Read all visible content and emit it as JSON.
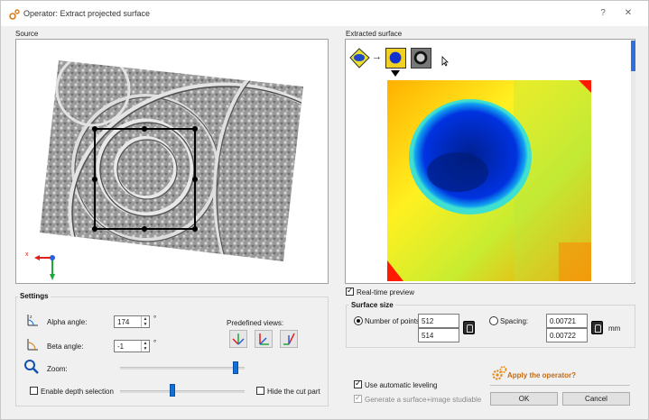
{
  "window": {
    "title": "Operator: Extract projected surface",
    "help_glyph": "?",
    "close_glyph": "✕"
  },
  "source": {
    "label": "Source"
  },
  "extracted": {
    "label": "Extracted surface",
    "arrow_glyph": "→"
  },
  "settings": {
    "title": "Settings",
    "alpha_label": "Alpha angle:",
    "alpha_value": "174",
    "beta_label": "Beta angle:",
    "beta_value": "-1",
    "degree_glyph": "°",
    "zoom_label": "Zoom:",
    "zoom_level": 0.95,
    "depth_label": "Enable depth selection",
    "depth_checked": false,
    "depth_level": 0.42,
    "hide_cut_label": "Hide the cut part",
    "hide_cut_checked": false,
    "predefined_label": "Predefined views:"
  },
  "realtime": {
    "label": "Real-time preview",
    "checked": true
  },
  "surface_size": {
    "title": "Surface size",
    "number_label": "Number of points:",
    "points_x": "512",
    "points_y": "514",
    "spacing_label": "Spacing:",
    "spacing_x": "0.00721",
    "spacing_y": "0.00722",
    "unit": "mm",
    "selected": "number"
  },
  "leveling": {
    "label": "Use automatic leveling",
    "checked": true
  },
  "generate": {
    "label": "Generate a surface+image studiable",
    "checked": true,
    "disabled": true
  },
  "apply": {
    "label": "Apply the operator?"
  },
  "buttons": {
    "ok": "OK",
    "cancel": "Cancel"
  },
  "colors": {
    "accent": "#1070d8",
    "apply": "#c46a12",
    "heatmap_low": "#0026c8",
    "heatmap_high": "#ff1a00"
  }
}
